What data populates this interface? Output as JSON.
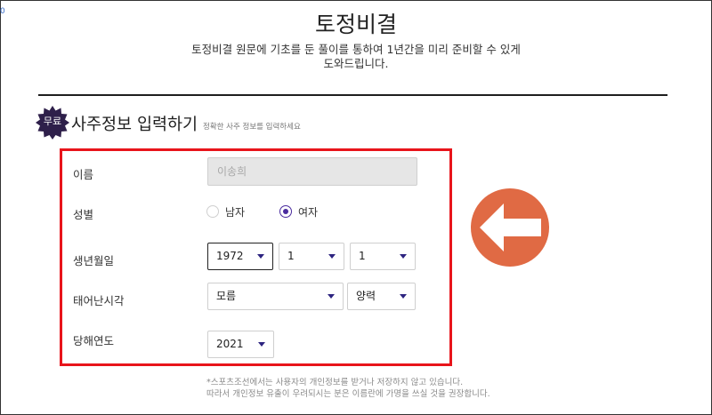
{
  "colors": {
    "accent_purple": "#4a2b9e",
    "badge_bg": "#2e1f4a",
    "highlight_red": "#e8141b",
    "arrow_orange": "#e06a44",
    "input_disabled_bg": "#e6e6e6"
  },
  "corner": "0",
  "header": {
    "title": "토정비결",
    "desc_line1": "토정비결 원문에 기초를 둔 풀이를 통하여 1년간을 미리 준비할 수 있게",
    "desc_line2": "도와드립니다."
  },
  "section": {
    "badge": "무료",
    "title": "사주정보 입력하기",
    "subtitle": "정확한 사주 정보를 입력하세요"
  },
  "form": {
    "name_label": "이름",
    "name_value": "이송희",
    "gender_label": "성별",
    "gender_options": [
      {
        "label": "남자",
        "selected": false
      },
      {
        "label": "여자",
        "selected": true
      }
    ],
    "birth_label": "생년월일",
    "birth_year": "1972",
    "birth_month": "1",
    "birth_day": "1",
    "birth_time_label": "태어난시각",
    "birth_time": "모름",
    "calendar_type": "양력",
    "target_year_label": "당해연도",
    "target_year": "2021"
  },
  "footnote": {
    "line1": "*스포츠조선에서는 사용자의 개인정보를 받거나 저장하지 않고 있습니다.",
    "line2": "따라서 개인정보 유출이 우려되시는 분은 이름란에 가명을 쓰실 것을 권장합니다."
  },
  "annotation": {
    "arrow_icon": "left-arrow-circle-icon"
  }
}
